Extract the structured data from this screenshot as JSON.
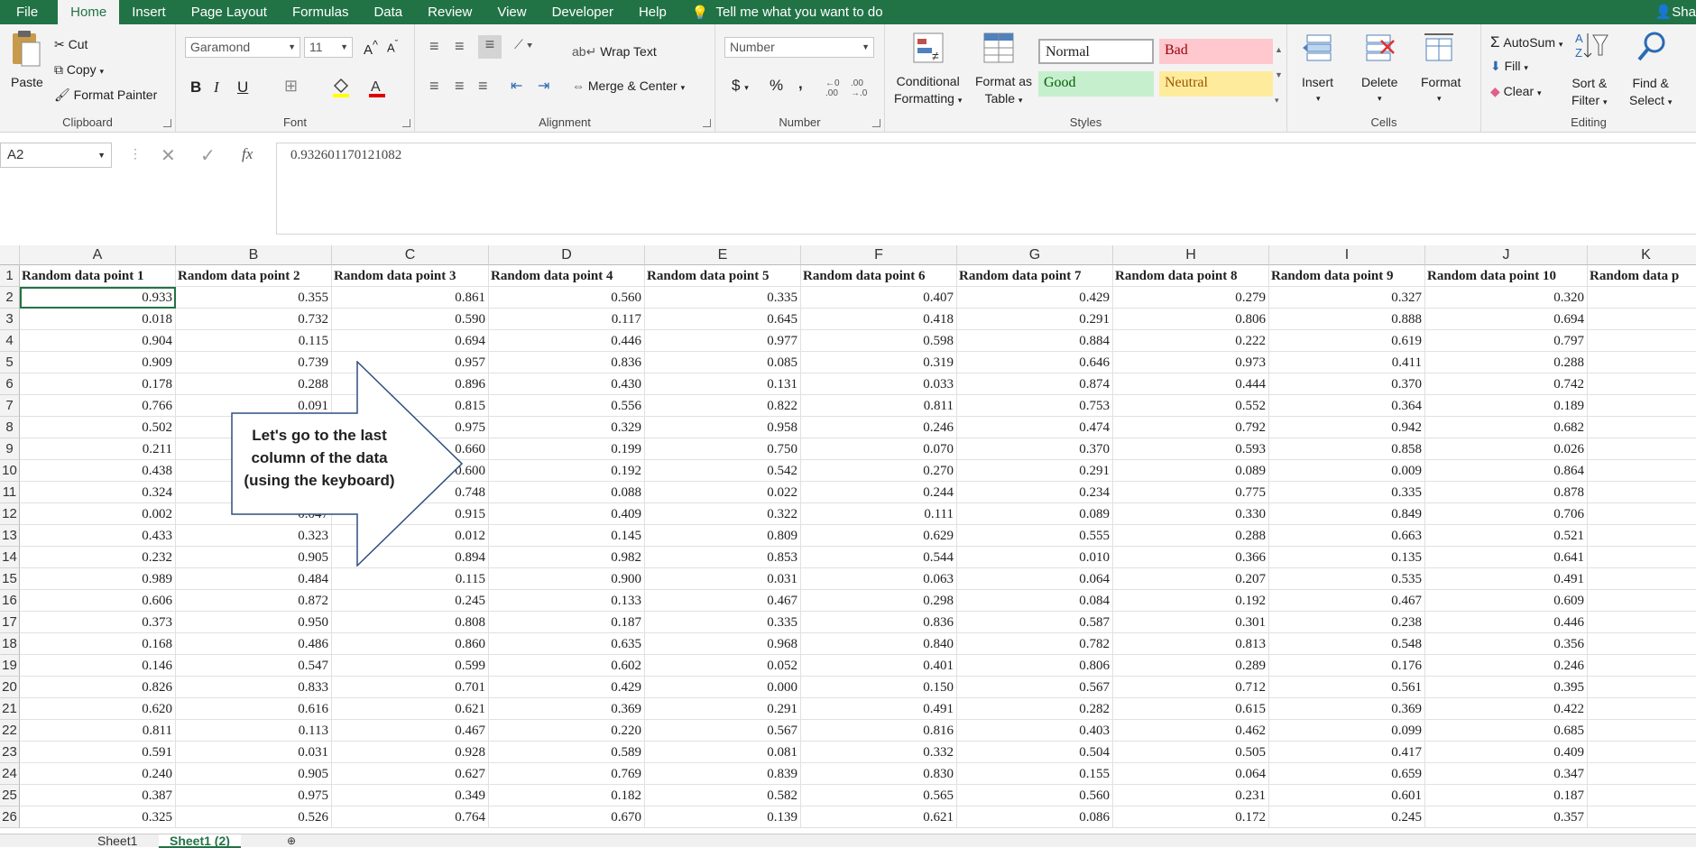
{
  "tabs": [
    "File",
    "Home",
    "Insert",
    "Page Layout",
    "Formulas",
    "Data",
    "Review",
    "View",
    "Developer",
    "Help"
  ],
  "tell_me": "Tell me what you want to do",
  "user": "Sha",
  "clipboard": {
    "paste": "Paste",
    "cut": "Cut",
    "copy": "Copy",
    "format_painter": "Format Painter",
    "label": "Clipboard"
  },
  "font": {
    "name": "Garamond",
    "size": "11",
    "bold": "B",
    "italic": "I",
    "underline": "U",
    "label": "Font"
  },
  "alignment": {
    "wrap": "Wrap Text",
    "merge": "Merge & Center",
    "label": "Alignment"
  },
  "number": {
    "format": "Number",
    "currency": "$",
    "percent": "%",
    "comma": ",",
    "label": "Number"
  },
  "styles": {
    "conditional": "Conditional",
    "conditional2": "Formatting",
    "format_as": "Format as",
    "format_as2": "Table",
    "normal": "Normal",
    "bad": "Bad",
    "good": "Good",
    "neutral": "Neutral",
    "label": "Styles"
  },
  "cells": {
    "insert": "Insert",
    "delete": "Delete",
    "format": "Format",
    "label": "Cells"
  },
  "editing": {
    "autosum": "AutoSum",
    "fill": "Fill",
    "clear": "Clear",
    "sort": "Sort &",
    "sort2": "Filter",
    "find": "Find &",
    "find2": "Select",
    "label": "Editing"
  },
  "formula_bar": {
    "name_box": "A2",
    "fx": "fx",
    "value": "0.932601170121082"
  },
  "columns": [
    "A",
    "B",
    "C",
    "D",
    "E",
    "F",
    "G",
    "H",
    "I",
    "J",
    "K"
  ],
  "headers": [
    "Random data point 1",
    "Random data point 2",
    "Random data point 3",
    "Random data point 4",
    "Random data point 5",
    "Random data point 6",
    "Random data point 7",
    "Random data point 8",
    "Random data point 9",
    "Random data point 10",
    "Random data p"
  ],
  "row_numbers": [
    "1",
    "2",
    "3",
    "4",
    "5",
    "6",
    "7",
    "8",
    "9",
    "10",
    "11",
    "12",
    "13",
    "14",
    "15",
    "16",
    "17",
    "18",
    "19",
    "20",
    "21",
    "22",
    "23",
    "24",
    "25",
    "26"
  ],
  "rows": [
    [
      "0.933",
      "0.355",
      "0.861",
      "0.560",
      "0.335",
      "0.407",
      "0.429",
      "0.279",
      "0.327",
      "0.320"
    ],
    [
      "0.018",
      "0.732",
      "0.590",
      "0.117",
      "0.645",
      "0.418",
      "0.291",
      "0.806",
      "0.888",
      "0.694"
    ],
    [
      "0.904",
      "0.115",
      "0.694",
      "0.446",
      "0.977",
      "0.598",
      "0.884",
      "0.222",
      "0.619",
      "0.797"
    ],
    [
      "0.909",
      "0.739",
      "0.957",
      "0.836",
      "0.085",
      "0.319",
      "0.646",
      "0.973",
      "0.411",
      "0.288"
    ],
    [
      "0.178",
      "0.288",
      "0.896",
      "0.430",
      "0.131",
      "0.033",
      "0.874",
      "0.444",
      "0.370",
      "0.742"
    ],
    [
      "0.766",
      "0.091",
      "0.815",
      "0.556",
      "0.822",
      "0.811",
      "0.753",
      "0.552",
      "0.364",
      "0.189"
    ],
    [
      "0.502",
      "",
      "0.975",
      "0.329",
      "0.958",
      "0.246",
      "0.474",
      "0.792",
      "0.942",
      "0.682"
    ],
    [
      "0.211",
      "",
      "0.660",
      "0.199",
      "0.750",
      "0.070",
      "0.370",
      "0.593",
      "0.858",
      "0.026"
    ],
    [
      "0.438",
      "",
      "0.600",
      "0.192",
      "0.542",
      "0.270",
      "0.291",
      "0.089",
      "0.009",
      "0.864"
    ],
    [
      "0.324",
      "",
      "0.748",
      "0.088",
      "0.022",
      "0.244",
      "0.234",
      "0.775",
      "0.335",
      "0.878"
    ],
    [
      "0.002",
      "0.047",
      "0.915",
      "0.409",
      "0.322",
      "0.111",
      "0.089",
      "0.330",
      "0.849",
      "0.706"
    ],
    [
      "0.433",
      "0.323",
      "0.012",
      "0.145",
      "0.809",
      "0.629",
      "0.555",
      "0.288",
      "0.663",
      "0.521"
    ],
    [
      "0.232",
      "0.905",
      "0.894",
      "0.982",
      "0.853",
      "0.544",
      "0.010",
      "0.366",
      "0.135",
      "0.641"
    ],
    [
      "0.989",
      "0.484",
      "0.115",
      "0.900",
      "0.031",
      "0.063",
      "0.064",
      "0.207",
      "0.535",
      "0.491"
    ],
    [
      "0.606",
      "0.872",
      "0.245",
      "0.133",
      "0.467",
      "0.298",
      "0.084",
      "0.192",
      "0.467",
      "0.609"
    ],
    [
      "0.373",
      "0.950",
      "0.808",
      "0.187",
      "0.335",
      "0.836",
      "0.587",
      "0.301",
      "0.238",
      "0.446"
    ],
    [
      "0.168",
      "0.486",
      "0.860",
      "0.635",
      "0.968",
      "0.840",
      "0.782",
      "0.813",
      "0.548",
      "0.356"
    ],
    [
      "0.146",
      "0.547",
      "0.599",
      "0.602",
      "0.052",
      "0.401",
      "0.806",
      "0.289",
      "0.176",
      "0.246"
    ],
    [
      "0.826",
      "0.833",
      "0.701",
      "0.429",
      "0.000",
      "0.150",
      "0.567",
      "0.712",
      "0.561",
      "0.395"
    ],
    [
      "0.620",
      "0.616",
      "0.621",
      "0.369",
      "0.291",
      "0.491",
      "0.282",
      "0.615",
      "0.369",
      "0.422"
    ],
    [
      "0.811",
      "0.113",
      "0.467",
      "0.220",
      "0.567",
      "0.816",
      "0.403",
      "0.462",
      "0.099",
      "0.685"
    ],
    [
      "0.591",
      "0.031",
      "0.928",
      "0.589",
      "0.081",
      "0.332",
      "0.504",
      "0.505",
      "0.417",
      "0.409"
    ],
    [
      "0.240",
      "0.905",
      "0.627",
      "0.769",
      "0.839",
      "0.830",
      "0.155",
      "0.064",
      "0.659",
      "0.347"
    ],
    [
      "0.387",
      "0.975",
      "0.349",
      "0.182",
      "0.582",
      "0.565",
      "0.560",
      "0.231",
      "0.601",
      "0.187"
    ],
    [
      "0.325",
      "0.526",
      "0.764",
      "0.670",
      "0.139",
      "0.621",
      "0.086",
      "0.172",
      "0.245",
      "0.357"
    ]
  ],
  "callout": [
    "Let's go to the last",
    "column of the data",
    "(using the keyboard)"
  ],
  "sheets": [
    "Sheet1",
    "Sheet1 (2)"
  ]
}
